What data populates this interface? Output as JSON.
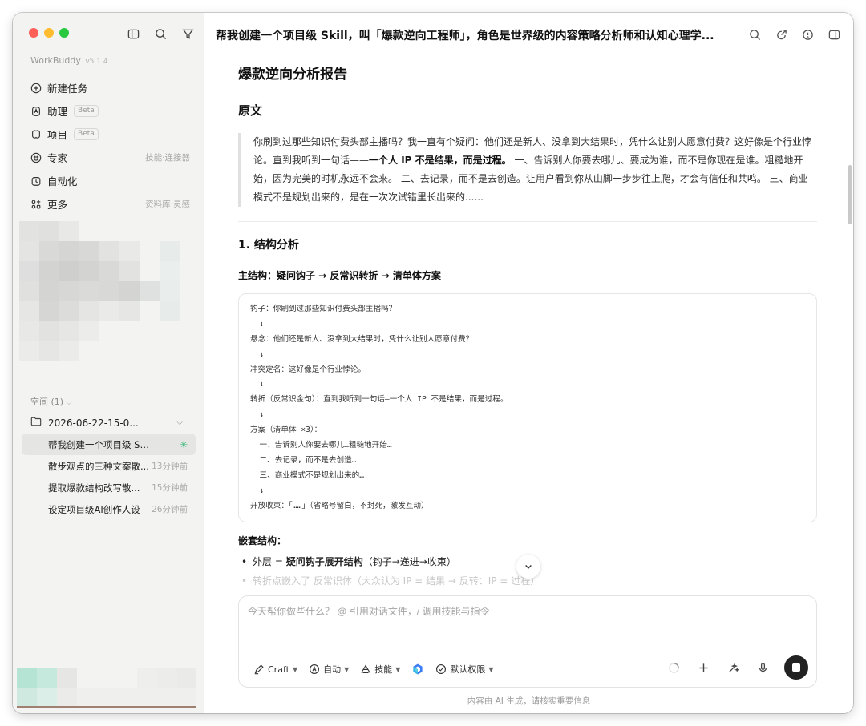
{
  "sidebar": {
    "brand": "WorkBuddy",
    "version": "v5.1.4",
    "nav": [
      {
        "label": "新建任务",
        "icon": "plus-circle-icon",
        "badge": "",
        "right": ""
      },
      {
        "label": "助理",
        "icon": "assistant-icon",
        "badge": "Beta",
        "right": ""
      },
      {
        "label": "项目",
        "icon": "project-icon",
        "badge": "Beta",
        "right": ""
      },
      {
        "label": "专家",
        "icon": "expert-icon",
        "badge": "",
        "right": "技能·连接器"
      },
      {
        "label": "自动化",
        "icon": "alarm-icon",
        "badge": "",
        "right": ""
      },
      {
        "label": "更多",
        "icon": "grid-icon",
        "badge": "",
        "right": "资料库·灵感"
      }
    ],
    "space_label": "空间 (1)",
    "project": "2026-06-22-15-0...",
    "chats": [
      {
        "title": "帮我创建一个项目级 Skill...",
        "time": "",
        "active": true
      },
      {
        "title": "散步观点的三种文案散...",
        "time": "13分钟前",
        "active": false
      },
      {
        "title": "提取爆款结构改写散...",
        "time": "15分钟前",
        "active": false
      },
      {
        "title": "设定项目级AI创作人设",
        "time": "26分钟前",
        "active": false
      }
    ]
  },
  "header": {
    "title": "帮我创建一个项目级 Skill，叫「爆款逆向工程师」，角色是世界级的内容策略分析师和认知心理学..."
  },
  "content": {
    "report_title": "爆款逆向分析报告",
    "original_heading": "原文",
    "quote_part1": "你刷到过那些知识付费头部主播吗？我一直有个疑问：他们还是新人、没拿到大结果时，凭什么让别人愿意付费？这好像是个行业悖论。直到我听到一句话——",
    "quote_bold": "一个人 IP 不是结果，而是过程。",
    "quote_part2": " 一、告诉别人你要去哪儿、要成为谁，而不是你现在是谁。粗糙地开始，因为完美的时机永远不会来。 二、去记录，而不是去创造。让用户看到你从山脚一步步往上爬，才会有信任和共鸣。 三、商业模式不是规划出来的，是在一次次试错里长出来的......",
    "section1": "1. 结构分析",
    "main_structure": "主结构：疑问钩子 → 反常识转折 → 清单体方案",
    "code_lines": [
      "钩子：你刷到过那些知识付费头部主播吗？",
      "  ↓",
      "悬念：他们还是新人、没拿到大结果时，凭什么让别人愿意付费？",
      "  ↓",
      "冲突定名：这好像是个行业悖论。",
      "  ↓",
      "转折（反常识金句）：直到我听到一句话—一个人 IP 不是结果，而是过程。",
      "  ↓",
      "方案（清单体 ×3）：",
      "  一、告诉别人你要去哪儿…粗糙地开始…",
      "  二、去记录，而不是去创造…",
      "  三、商业模式不是规划出来的…",
      "  ↓",
      "开放收束：「……」（省略号留白，不封死，激发互动）"
    ],
    "nested_heading": "嵌套结构：",
    "bullets": [
      {
        "pre": "外层 = ",
        "bold": "疑问钩子展开结构",
        "post": "（钩子→递进→收束）"
      },
      {
        "pre": "转折点嵌入了 ",
        "bold": "反常识体",
        "post": "（大众认为 IP = 结果 → 反转：IP = 过程）"
      }
    ]
  },
  "composer": {
    "placeholder": "今天帮你做些什么？ @ 引用对话文件，/ 调用技能与指令",
    "tools": [
      {
        "label": "Craft",
        "icon": "pen-icon"
      },
      {
        "label": "自动",
        "icon": "auto-icon"
      },
      {
        "label": "技能",
        "icon": "skill-icon"
      },
      {
        "label": "",
        "icon": "model-logo-icon"
      },
      {
        "label": "默认权限",
        "icon": "shield-check-icon"
      }
    ]
  },
  "footer": "内容由 AI 生成，请核实重要信息",
  "colors": {
    "sidebar_bg": "#f3f3f2",
    "active_chat_bg": "#e5e5e3",
    "accent_green": "#2bb673"
  }
}
